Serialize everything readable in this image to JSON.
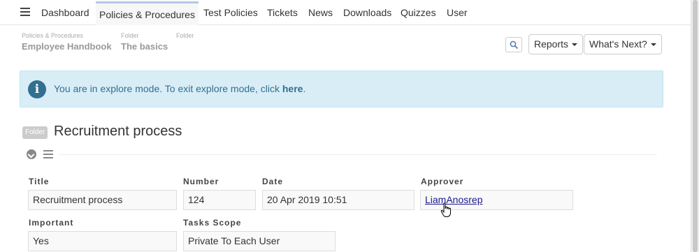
{
  "nav": {
    "items": [
      "Dashboard",
      "Policies & Procedures",
      "Test Policies",
      "Tickets",
      "News",
      "Downloads",
      "Quizzes",
      "User"
    ]
  },
  "breadcrumb": [
    {
      "type": "Policies & Procedures",
      "name": "Employee Handbook"
    },
    {
      "type": "Folder",
      "name": "The basics"
    },
    {
      "type": "Folder",
      "name": ""
    }
  ],
  "toolbar": {
    "reports_label": "Reports",
    "whats_next_label": "What's Next?"
  },
  "alert": {
    "text": "You are in explore mode. To exit explore mode, click",
    "link": "here",
    "suffix": "."
  },
  "folder": {
    "badge": "Folder",
    "title": "Recruitment process"
  },
  "fields": {
    "title_label": "Title",
    "title_value": "Recruitment process",
    "number_label": "Number",
    "number_value": "124",
    "date_label": "Date",
    "date_value": "20 Apr 2019 10:51",
    "approver_label": "Approver",
    "approver_value": "LiamAnosrep",
    "important_label": "Important",
    "important_value": "Yes",
    "tasks_scope_label": "Tasks Scope",
    "tasks_scope_value": "Private To Each User"
  },
  "colors": {
    "alert_bg": "#d9edf7",
    "alert_text": "#31708f",
    "active_tab_border": "#b5c6e8"
  }
}
